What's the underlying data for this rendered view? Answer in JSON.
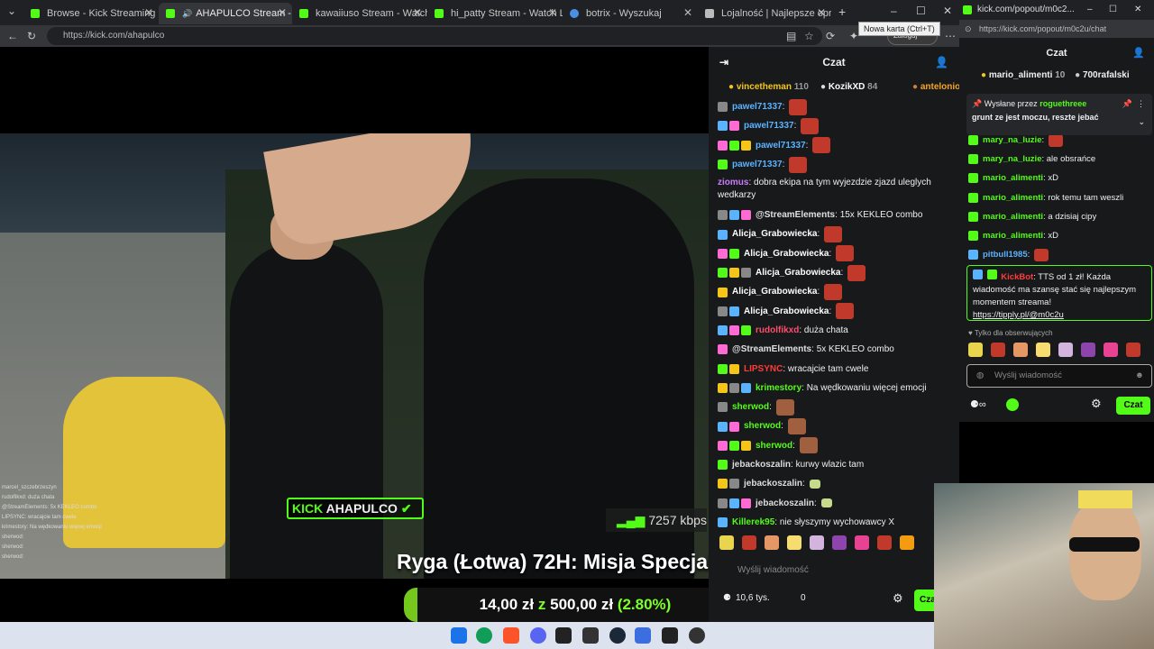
{
  "browser": {
    "tabs": [
      {
        "title": "Browse - Kick Streaming",
        "active": false,
        "favicon_color": "#53fc18"
      },
      {
        "title": "AHAPULCO Stream - Watch",
        "active": true,
        "favicon_color": "#53fc18"
      },
      {
        "title": "kawaiiuso Stream - Watch Live",
        "active": false,
        "favicon_color": "#53fc18"
      },
      {
        "title": "hi_patty Stream - Watch Live o",
        "active": false,
        "favicon_color": "#53fc18"
      },
      {
        "title": "botrix - Wyszukaj",
        "active": false,
        "favicon_color": "#4a90e2"
      },
      {
        "title": "Lojalność | Najlepsze oprogram",
        "active": false,
        "favicon_color": "#bbbbbb"
      }
    ],
    "new_tab_tooltip": "Nowa karta (Ctrl+T)",
    "url": "https://kick.com/ahapulco",
    "login_label": "Zaloguj"
  },
  "video": {
    "channel_overlay": "AHAPULCO",
    "kick_word": "KICK",
    "bitrate": "7257 kbps",
    "goal_title": "Ryga (Łotwa) 72H: Misja Specjalna",
    "goal_current": "14,00 zł",
    "goal_sep": "z",
    "goal_target": "500,00 zł",
    "goal_percent": "(2.80%)",
    "goal_fraction": 0.028,
    "mini_chat": [
      "marcel_szczebrzeszyn",
      "rudolfikxd: duża chata",
      "@StreamElements: 5x KEKLEO combo",
      "LIPSYNC: wracajcie tam cwele",
      "krimestory: Na wędkowaniu więcej emocji",
      "sherwod:",
      "sherwod:",
      "sherwod:"
    ]
  },
  "chat": {
    "header": "Czat",
    "leaderboard": [
      {
        "name": "vincetheman",
        "score": "110",
        "color": "#f5c518"
      },
      {
        "name": "KozikXD",
        "score": "84",
        "color": "#ffffff"
      },
      {
        "name": "antelonio",
        "score": "",
        "color": "#f5a623"
      }
    ],
    "messages": [
      {
        "user": "pawel71337",
        "color": "#5ab3ff",
        "text": "",
        "emote": true
      },
      {
        "user": "pawel71337",
        "color": "#5ab3ff",
        "text": "",
        "emote": true
      },
      {
        "user": "pawel71337",
        "color": "#5ab3ff",
        "text": "",
        "emote": true
      },
      {
        "user": "pawel71337",
        "color": "#5ab3ff",
        "text": "",
        "emote": true
      },
      {
        "user": "ziomus",
        "color": "#c97cff",
        "text": "dobra ekipa na tym wyjezdzie zjazd uleglych wedkarzy",
        "emote": false,
        "tall": true
      },
      {
        "user": "@StreamElements",
        "color": "#e0e0e0",
        "text": "15x KEKLEO combo",
        "emote": false
      },
      {
        "user": "Alicja_Grabowiecka",
        "color": "#ffffff",
        "text": "",
        "emote": true
      },
      {
        "user": "Alicja_Grabowiecka",
        "color": "#ffffff",
        "text": "",
        "emote": true
      },
      {
        "user": "Alicja_Grabowiecka",
        "color": "#ffffff",
        "text": "",
        "emote": true
      },
      {
        "user": "Alicja_Grabowiecka",
        "color": "#ffffff",
        "text": "",
        "emote": true
      },
      {
        "user": "Alicja_Grabowiecka",
        "color": "#ffffff",
        "text": "",
        "emote": true
      },
      {
        "user": "rudolfikxd",
        "color": "#ff4d6d",
        "text": "duża chata",
        "emote": false
      },
      {
        "user": "@StreamElements",
        "color": "#e0e0e0",
        "text": "5x KEKLEO combo",
        "emote": false
      },
      {
        "user": "LIPSYNC",
        "color": "#ff3b3b",
        "text": "wracajcie tam cwele",
        "emote": false
      },
      {
        "user": "krimestory",
        "color": "#53fc18",
        "text": "Na wędkowaniu więcej emocji",
        "emote": false
      },
      {
        "user": "sherwod",
        "color": "#53fc18",
        "text": "",
        "emote": true
      },
      {
        "user": "sherwod",
        "color": "#53fc18",
        "text": "",
        "emote": true
      },
      {
        "user": "sherwod",
        "color": "#53fc18",
        "text": "",
        "emote": true
      },
      {
        "user": "jebackoszalin",
        "color": "#dddddd",
        "text": "kurwy wlazic tam",
        "emote": false
      },
      {
        "user": "jebackoszalin",
        "color": "#dddddd",
        "text": "",
        "emote": true
      },
      {
        "user": "jebackoszalin",
        "color": "#dddddd",
        "text": "",
        "emote": true
      },
      {
        "user": "Killerek95",
        "color": "#53fc18",
        "text": "nie słyszymy wychowawcy X",
        "emote": false
      }
    ],
    "input_placeholder": "Wyślij wiadomość",
    "points": "10,6 tys.",
    "points2": "0",
    "send_label": "Czat"
  },
  "popout": {
    "window_title": "kick.com/popout/m0c2...",
    "url": "https://kick.com/popout/m0c2u/chat",
    "header": "Czat",
    "leaderboard": [
      {
        "name": "mario_alimenti",
        "score": "10"
      },
      {
        "name": "700rafalski",
        "score": ""
      }
    ],
    "pinned_by_label": "Wysłane przez",
    "pinned_user": "roguethreee",
    "pinned_text": "grunt ze jest moczu, reszte jebać",
    "messages": [
      {
        "user": "mary_na_luzie",
        "color": "#53fc18",
        "text": ""
      },
      {
        "user": "mary_na_luzie",
        "color": "#53fc18",
        "text": "ale obsrańce"
      },
      {
        "user": "mario_alimenti",
        "color": "#53fc18",
        "text": "xD"
      },
      {
        "user": "mario_alimenti",
        "color": "#53fc18",
        "text": "rok temu tam weszli"
      },
      {
        "user": "mario_alimenti",
        "color": "#53fc18",
        "text": "a dzisiaj cipy"
      },
      {
        "user": "mario_alimenti",
        "color": "#53fc18",
        "text": "xD"
      },
      {
        "user": "pitbull1985",
        "color": "#5ab3ff",
        "text": ""
      }
    ],
    "kickbot_user": "KickBot",
    "kickbot_text": "TTS od 1 zł! Każda wiadomość ma szansę stać się najlepszym momentem streama!",
    "kickbot_link": "https://tipply.pl/@m0c2u",
    "followers_only": "Tylko dla obserwujących",
    "input_placeholder": "Wyślij wiadomość",
    "send_label": "Czat"
  },
  "colors": {
    "kick_green": "#53fc18",
    "chat_bg": "#18191b",
    "taskbar": "#dce3ee"
  }
}
